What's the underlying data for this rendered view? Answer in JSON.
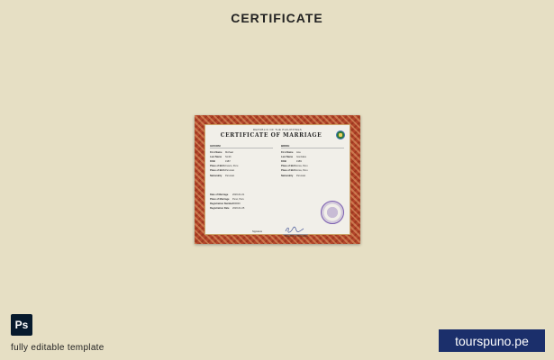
{
  "page": {
    "title": "CERTIFICATE"
  },
  "certificate": {
    "republic": "REPUBLIC OF THE PHILIPPINES",
    "heading": "CERTIFICATE OF MARRIAGE",
    "groom": {
      "header": "GROOM",
      "rows": [
        {
          "label": "First Name",
          "value": "Michael"
        },
        {
          "label": "Last Name",
          "value": "Smith"
        },
        {
          "label": "DOB",
          "value": "1987"
        },
        {
          "label": "Place of Birth",
          "value": "Cusco, Peru"
        },
        {
          "label": "Place of Birth",
          "value": "Peruvian"
        },
        {
          "label": "Nationality",
          "value": "Peruvian"
        }
      ]
    },
    "bride": {
      "header": "BRIDE",
      "rows": [
        {
          "label": "First Name",
          "value": "Ana"
        },
        {
          "label": "Last Name",
          "value": "Gonzales"
        },
        {
          "label": "DOB",
          "value": "1989"
        },
        {
          "label": "Place of Birth",
          "value": "Lima, Peru"
        },
        {
          "label": "Place of Birth",
          "value": "Lima, Peru"
        },
        {
          "label": "Nationality",
          "value": "Peruvian"
        }
      ]
    },
    "details": [
      {
        "label": "Date of Marriage",
        "value": "2020-01-01"
      },
      {
        "label": "Place of Marriage",
        "value": "Puno, Peru"
      },
      {
        "label": "Registration Number",
        "value": "000000"
      },
      {
        "label": "Registration Date",
        "value": "2020-01-05"
      }
    ],
    "signature_label": "Signature",
    "registrar_label": "Registrar of Marriages"
  },
  "footer": {
    "ps_label": "Ps",
    "caption": "fully editable template",
    "brand": "tourspuno.pe"
  },
  "colors": {
    "background": "#e6dfc4",
    "frame": "#b3452a",
    "brand_bg": "#1b2f6b",
    "ps_bg": "#071a2d"
  }
}
